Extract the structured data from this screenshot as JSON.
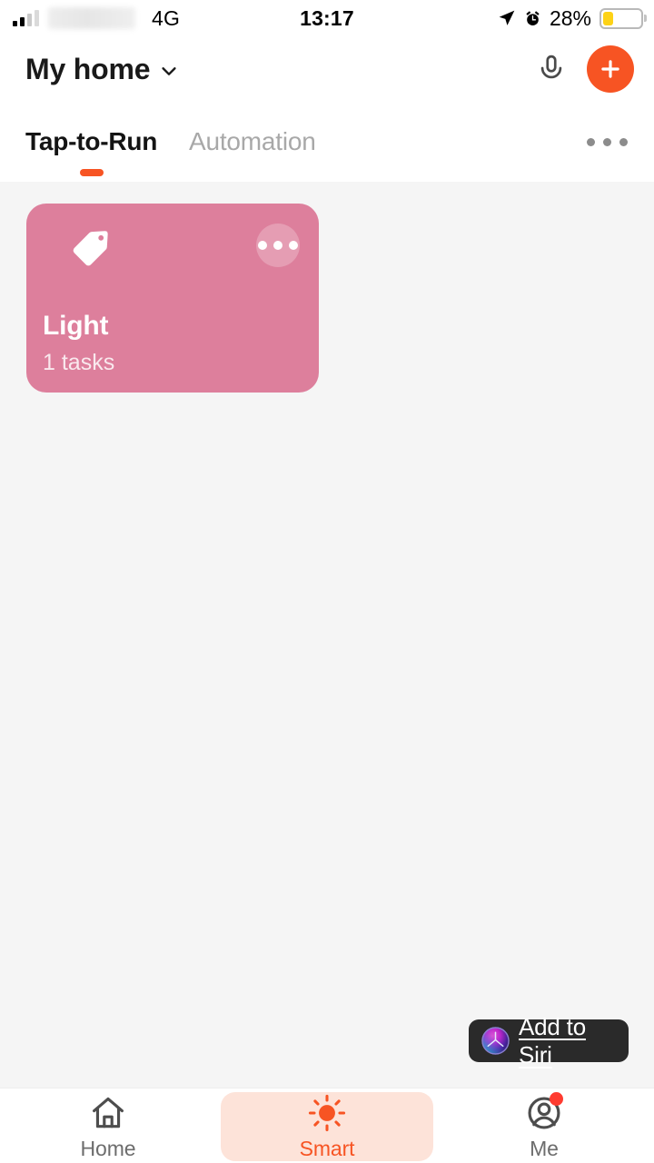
{
  "status_bar": {
    "network_type": "4G",
    "time": "13:17",
    "battery_percent": "28%",
    "battery_level": 28,
    "icons": {
      "signal": "signal-bars-icon",
      "location": "location-arrow-icon",
      "alarm": "alarm-clock-icon",
      "battery": "battery-icon"
    },
    "carrier_redacted": true
  },
  "header": {
    "home_name": "My home",
    "chevron": "chevron-down-icon",
    "mic_icon": "microphone-icon",
    "add_icon": "plus-icon"
  },
  "tabs": {
    "items": [
      {
        "label": "Tap-to-Run",
        "active": true
      },
      {
        "label": "Automation",
        "active": false
      }
    ],
    "more_icon": "more-horizontal-icon"
  },
  "scenes": [
    {
      "title": "Light",
      "subtitle": "1 tasks",
      "color": "#dd7f9c",
      "icon": "tag-icon",
      "more_icon": "more-horizontal-icon"
    }
  ],
  "siri": {
    "label": "Add to Siri",
    "icon": "siri-orb-icon"
  },
  "bottom_nav": {
    "items": [
      {
        "label": "Home",
        "icon": "house-icon",
        "active": false,
        "badge": false
      },
      {
        "label": "Smart",
        "icon": "sun-icon",
        "active": true,
        "badge": false
      },
      {
        "label": "Me",
        "icon": "person-icon",
        "active": false,
        "badge": true
      }
    ]
  },
  "colors": {
    "accent": "#f75423",
    "accent_soft": "#fde3d9",
    "card_pink": "#dd7f9c",
    "page_bg": "#f5f5f5",
    "badge_red": "#ff3b30",
    "battery_yellow": "#fdd216"
  }
}
